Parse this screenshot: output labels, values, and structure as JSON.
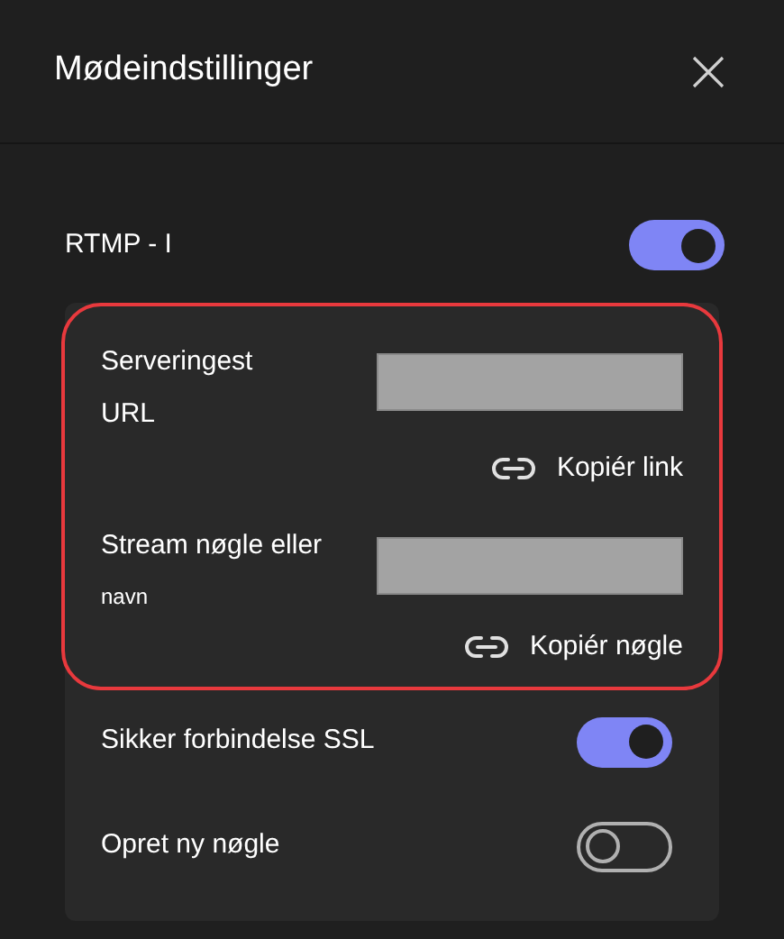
{
  "dialog": {
    "title": "Mødeindstillinger"
  },
  "rtmp": {
    "label": "RTMP - I",
    "on": true
  },
  "fields": [
    {
      "lines": [
        {
          "text": "Serveringest",
          "small": false
        },
        {
          "text": "URL",
          "small": false
        }
      ],
      "action": "Kopiér link"
    },
    {
      "lines": [
        {
          "text": "Stream nøgle eller",
          "small": false
        },
        {
          "text": "navn",
          "small": true
        }
      ],
      "action": "Kopiér nøgle"
    }
  ],
  "toggles": [
    {
      "label": "Sikker forbindelse SSL",
      "on": true
    },
    {
      "label": "Opret ny nøgle",
      "on": false
    }
  ]
}
